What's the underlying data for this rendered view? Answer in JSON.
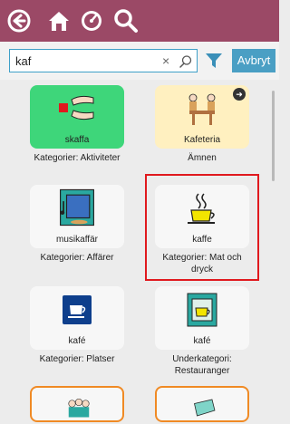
{
  "search": {
    "value": "kaf",
    "clear_glyph": "×"
  },
  "toolbar": {
    "cancel_label": "Avbryt"
  },
  "icons": [
    "back-icon",
    "home-icon",
    "speedometer-icon",
    "search-icon",
    "filter-icon"
  ],
  "colors": {
    "topbar": "#9b4966",
    "accent": "#4a9fc4",
    "activity_tile": "#3ed67a",
    "subject_tile": "#fff0c0",
    "category_tile_border": "#f08a24",
    "highlight": "#e0191e"
  },
  "results": [
    {
      "word": "skaffa",
      "caption": "Kategorier: Aktiviteter"
    },
    {
      "word": "Kafeteria",
      "caption": "Ämnen",
      "badge": "➜"
    },
    {
      "word": "musikaffär",
      "caption": "Kategorier: Affärer"
    },
    {
      "word": "kaffe",
      "caption": "Kategorier: Mat och dryck",
      "selected": true
    },
    {
      "word": "kafé",
      "caption": "Kategorier: Platser"
    },
    {
      "word": "kafé",
      "caption": "Underkategori: Restauranger"
    }
  ]
}
